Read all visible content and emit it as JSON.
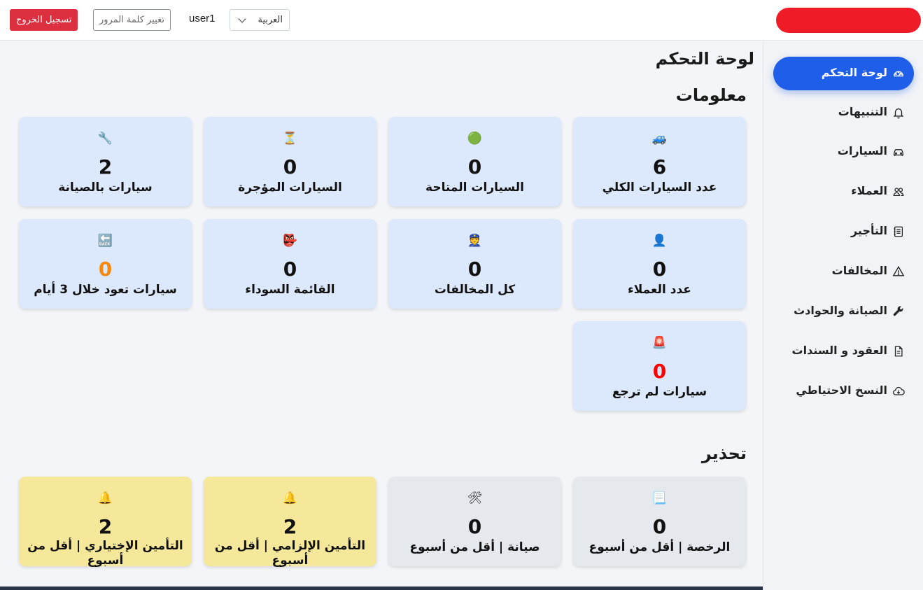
{
  "header": {
    "logout_label": "تسجيل الخروج",
    "change_password_label": "تغيير كلمة المرور",
    "username": "user1",
    "language": "العربية"
  },
  "colors": {
    "primary": "#1f5ee8",
    "danger": "#dc2f3f",
    "card_blue": "#dce8fb",
    "card_gray": "#e5e8ed",
    "card_yellow": "#f6e89a",
    "value_orange": "#f7890c",
    "value_red": "#ff0000"
  },
  "sidebar": {
    "items": [
      {
        "label": "لوحة التحكم",
        "icon": "speedometer-icon",
        "active": true
      },
      {
        "label": "التنبيهات",
        "icon": "bell-icon"
      },
      {
        "label": "السيارات",
        "icon": "car-icon"
      },
      {
        "label": "العملاء",
        "icon": "people-icon"
      },
      {
        "label": "التأجير",
        "icon": "journal-icon"
      },
      {
        "label": "المخالفات",
        "icon": "warning-triangle-icon"
      },
      {
        "label": "الصيانة والحوادث",
        "icon": "wrench-icon"
      },
      {
        "label": "العقود و السندات",
        "icon": "document-icon"
      },
      {
        "label": "النسخ الاحتياطي",
        "icon": "cloud-download-icon"
      }
    ]
  },
  "main": {
    "title": "لوحة التحكم",
    "info_title": "معلومات",
    "warning_title": "تحذير",
    "info_cards": [
      {
        "label": "عدد السيارات الكلي",
        "value": "6",
        "icon": "🚙",
        "icon_name": "car-emoji-icon"
      },
      {
        "label": "السيارات المتاحة",
        "value": "0",
        "icon": "🟢",
        "icon_name": "green-circle-icon"
      },
      {
        "label": "السيارات المؤجرة",
        "value": "0",
        "icon": "⏳",
        "icon_name": "hourglass-icon"
      },
      {
        "label": "سيارات بالصيانة",
        "value": "2",
        "icon": "🔧",
        "icon_name": "wrench-emoji-icon"
      },
      {
        "label": "عدد العملاء",
        "value": "0",
        "icon": "👤",
        "icon_name": "person-silhouette-icon"
      },
      {
        "label": "كل المخالفات",
        "value": "0",
        "icon": "👮",
        "icon_name": "police-officer-icon"
      },
      {
        "label": "القائمة السوداء",
        "value": "0",
        "icon": "👺",
        "icon_name": "goblin-mask-icon"
      },
      {
        "label": "سيارات تعود خلال 3 أيام",
        "value": "0",
        "icon": "🔙",
        "icon_name": "back-arrow-icon"
      },
      {
        "label": "سيارات لم ترجع",
        "value": "0",
        "icon": "🚨",
        "icon_name": "siren-light-icon"
      }
    ],
    "warning_cards": [
      {
        "label": "الرخصة | أقل من أسبوع",
        "value": "0",
        "icon": "📃",
        "icon_name": "page-icon"
      },
      {
        "label": "صيانة | أقل من أسبوع",
        "value": "0",
        "icon": "🛠",
        "icon_name": "tools-icon"
      },
      {
        "label": "التأمين الإلزامي | أقل من أسبوع",
        "value": "2",
        "icon": "🔔",
        "icon_name": "bell-emoji-icon"
      },
      {
        "label": "التأمين الإختياري | أقل من أسبوع",
        "value": "2",
        "icon": "🔔",
        "icon_name": "bell-emoji-icon"
      }
    ]
  }
}
